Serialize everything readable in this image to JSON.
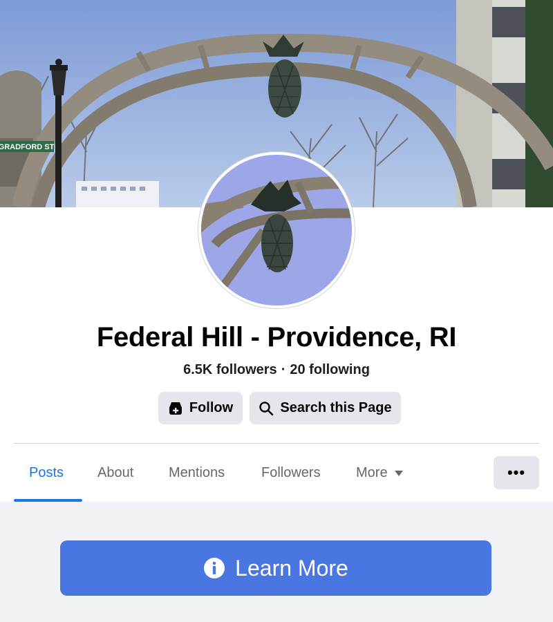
{
  "cover": {
    "street_sign": "GRADFORD ST"
  },
  "page": {
    "title": "Federal Hill - Providence, RI",
    "followers": "6.5K followers",
    "separator": "·",
    "following": "20 following"
  },
  "actions": {
    "follow_label": "Follow",
    "follow_icon": "follow-icon",
    "search_label": "Search this Page",
    "search_icon": "search-icon"
  },
  "tabs": [
    {
      "label": "Posts",
      "active": true
    },
    {
      "label": "About",
      "active": false
    },
    {
      "label": "Mentions",
      "active": false
    },
    {
      "label": "Followers",
      "active": false
    },
    {
      "label": "More",
      "active": false
    }
  ],
  "more_button": {
    "label": "•••"
  },
  "cta": {
    "label": "Learn More",
    "icon": "info-icon"
  },
  "colors": {
    "accent": "#1b74e4",
    "cta": "#4a76e2",
    "button_bg": "#e4e6eb",
    "feed_bg": "#f0f2f5",
    "muted_text": "#65676b"
  }
}
